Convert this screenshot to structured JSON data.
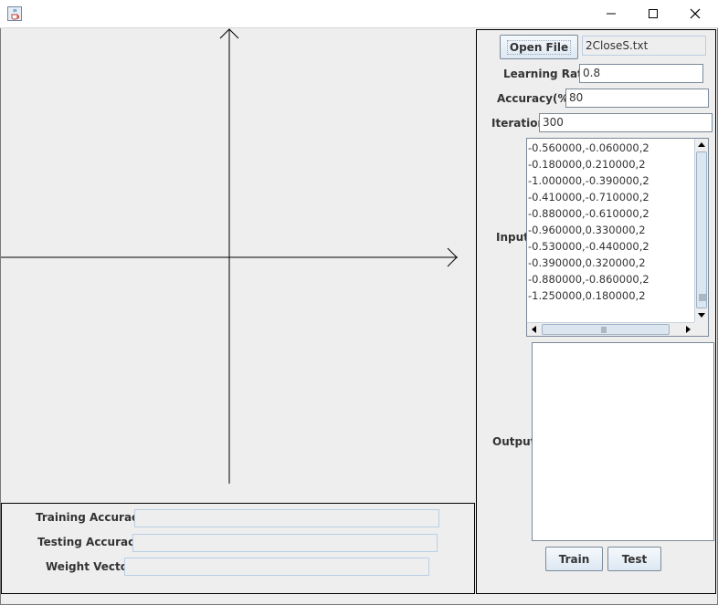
{
  "window": {
    "title": "",
    "icon": "java-cup-icon",
    "controls": [
      "minimize-icon",
      "maximize-icon",
      "close-icon"
    ]
  },
  "stats": {
    "training_accuracy_label": "Training Accuracy",
    "training_accuracy_value": "",
    "testing_accuracy_label": "Testing Accuracy",
    "testing_accuracy_value": "",
    "weight_vector_label": "Weight Vector",
    "weight_vector_value": ""
  },
  "controls": {
    "open_file_label": "Open File",
    "file_name": "2CloseS.txt",
    "learning_rate_label": "Learning Rate",
    "learning_rate_value": "0.8",
    "accuracy_label": "Accuracy(%)",
    "accuracy_value": "80",
    "iteration_label": "Iteration",
    "iteration_value": "300",
    "input_label": "Input",
    "output_label": "Output",
    "output_value": "",
    "train_label": "Train",
    "test_label": "Test"
  },
  "input_lines": [
    "-0.560000,-0.060000,2",
    "-0.180000,0.210000,2",
    "-1.000000,-0.390000,2",
    "-0.410000,-0.710000,2",
    "-0.880000,-0.610000,2",
    "-0.960000,0.330000,2",
    "-0.530000,-0.440000,2",
    "-0.390000,0.320000,2",
    "-0.880000,-0.860000,2",
    "-1.250000,0.180000,2"
  ],
  "colors": {
    "panel_background": "#eeeeee",
    "field_border": "#7a8a99",
    "readonly_border": "#b8cfe5",
    "axis_color": "#000000"
  }
}
